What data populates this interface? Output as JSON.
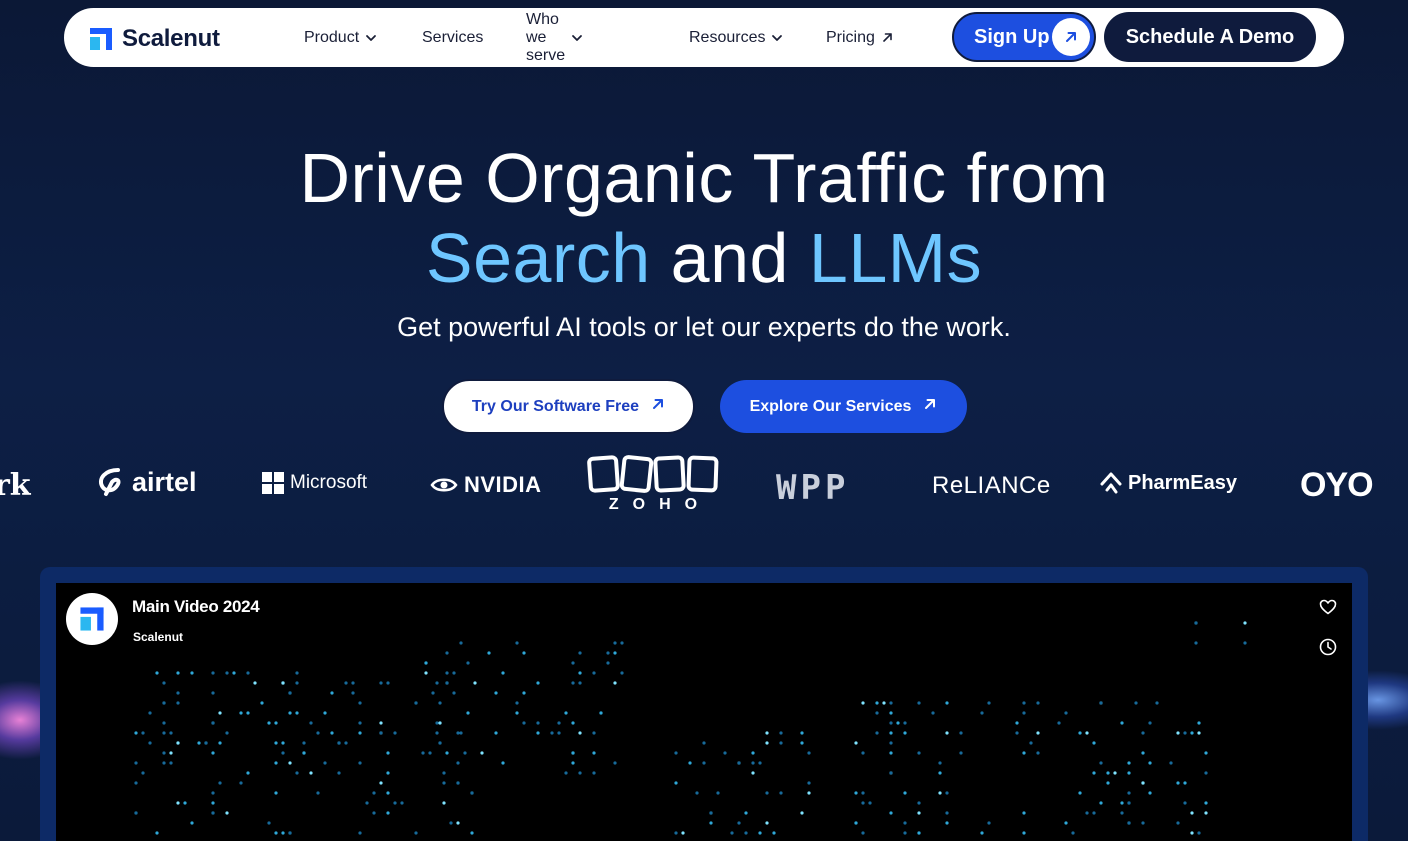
{
  "nav": {
    "brand": "Scalenut",
    "items": [
      {
        "label": "Product",
        "dropdown": true
      },
      {
        "label": "Services",
        "dropdown": false
      },
      {
        "label": "Who we serve",
        "dropdown": true
      },
      {
        "label": "Resources",
        "dropdown": true
      },
      {
        "label": "Pricing",
        "external": true
      }
    ],
    "signup_label": "Sign Up",
    "demo_label": "Schedule A Demo"
  },
  "hero": {
    "line1": "Drive Organic Traffic from",
    "line2_a": "Search",
    "line2_b": " and ",
    "line2_c": "LLMs",
    "subtitle": "Get powerful AI tools or let our experts do the work."
  },
  "cta": {
    "primary_label": "Try Our Software Free",
    "secondary_label": "Explore Our Services"
  },
  "logos": {
    "work": "rk",
    "airtel": "airtel",
    "microsoft": "Microsoft",
    "nvidia": "NVIDIA",
    "zoho": "ZOHO",
    "wpp": "WPP",
    "reliance": "ReLIANCe",
    "pharmeasy": "PharmEasy",
    "oyo": "OYO"
  },
  "video": {
    "title": "Main Video 2024",
    "channel": "Scalenut"
  },
  "colors": {
    "accent": "#6ec6ff",
    "primary_blue": "#1d4fe0",
    "navy": "#0f1b3d",
    "background": "#0d1f45"
  }
}
